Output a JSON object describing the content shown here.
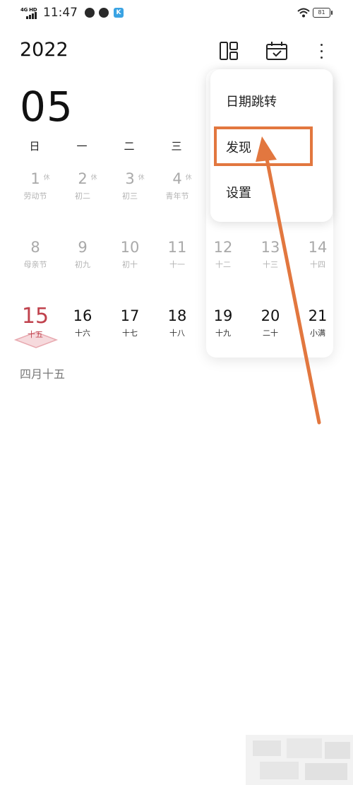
{
  "status_bar": {
    "network": "4G HD",
    "time": "11:47",
    "battery": "81"
  },
  "header": {
    "year": "2022",
    "icons": [
      "layout-icon",
      "calendar-check-icon",
      "more-vertical-icon"
    ]
  },
  "month": "05",
  "weekdays": [
    "日",
    "一",
    "二",
    "三"
  ],
  "weeks": [
    [
      {
        "num": "1",
        "rest": "休",
        "sub": "劳动节",
        "style": "muted"
      },
      {
        "num": "2",
        "rest": "休",
        "sub": "初二",
        "style": "muted"
      },
      {
        "num": "3",
        "rest": "休",
        "sub": "初三",
        "style": "muted"
      },
      {
        "num": "4",
        "rest": "休",
        "sub": "青年节",
        "style": "muted"
      }
    ],
    [
      {
        "num": "8",
        "sub": "母亲节",
        "style": "muted"
      },
      {
        "num": "9",
        "sub": "初九",
        "style": "muted"
      },
      {
        "num": "10",
        "sub": "初十",
        "style": "muted"
      },
      {
        "num": "11",
        "sub": "十一",
        "style": "muted"
      },
      {
        "num": "12",
        "sub": "十二",
        "style": "muted"
      },
      {
        "num": "13",
        "sub": "十三",
        "style": "muted"
      },
      {
        "num": "14",
        "sub": "十四",
        "style": "muted"
      }
    ],
    [
      {
        "num": "15",
        "sub": "十五",
        "style": "today"
      },
      {
        "num": "16",
        "sub": "十六",
        "style": "dark"
      },
      {
        "num": "17",
        "sub": "十七",
        "style": "dark"
      },
      {
        "num": "18",
        "sub": "十八",
        "style": "dark"
      },
      {
        "num": "19",
        "sub": "十九",
        "style": "dark"
      },
      {
        "num": "20",
        "sub": "二十",
        "style": "dark"
      },
      {
        "num": "21",
        "sub": "小满",
        "style": "dark"
      }
    ]
  ],
  "selected_lunar_date": "四月十五",
  "menu": {
    "items": [
      "日期跳转",
      "发现",
      "设置"
    ],
    "highlighted": "发现"
  },
  "colors": {
    "accent": "#c0424d",
    "annotation": "#e2773f"
  }
}
